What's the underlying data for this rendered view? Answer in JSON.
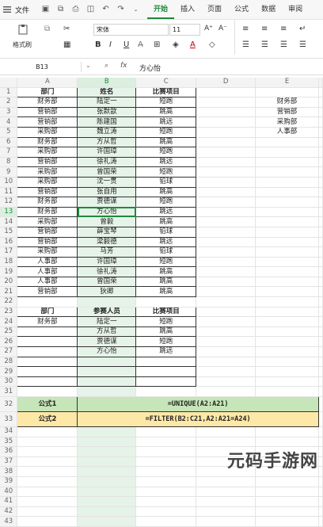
{
  "menubar": {
    "file_label": "文件"
  },
  "tabs": [
    "开始",
    "插入",
    "页面",
    "公式",
    "数据",
    "审阅"
  ],
  "ribbon": {
    "format_brush": "格式刷",
    "font": "宋体",
    "font_size": "11",
    "bold": "B",
    "italic": "I",
    "underline": "U",
    "font_color_label": "A"
  },
  "formula_bar": {
    "cell_ref": "B13",
    "fx": "fx",
    "value": "方心怡"
  },
  "columns": [
    "A",
    "B",
    "C",
    "D",
    "E"
  ],
  "rows": [
    {
      "n": "1",
      "a": "部门",
      "b": "姓名",
      "c": "比赛项目",
      "e": ""
    },
    {
      "n": "2",
      "a": "财务部",
      "b": "陆定一",
      "c": "短跑",
      "e": "财务部"
    },
    {
      "n": "3",
      "a": "营销部",
      "b": "张默歆",
      "c": "跳高",
      "e": "营销部"
    },
    {
      "n": "4",
      "a": "营销部",
      "b": "陈建国",
      "c": "跳远",
      "e": "采购部"
    },
    {
      "n": "5",
      "a": "采购部",
      "b": "魏立涛",
      "c": "短跑",
      "e": "人事部"
    },
    {
      "n": "6",
      "a": "财务部",
      "b": "方从哲",
      "c": "跳高",
      "e": ""
    },
    {
      "n": "7",
      "a": "采购部",
      "b": "许国璋",
      "c": "短跑",
      "e": ""
    },
    {
      "n": "8",
      "a": "营销部",
      "b": "徐礼涛",
      "c": "跳远",
      "e": ""
    },
    {
      "n": "9",
      "a": "采购部",
      "b": "曾国荣",
      "c": "短跑",
      "e": ""
    },
    {
      "n": "10",
      "a": "采购部",
      "b": "沈一贯",
      "c": "铅球",
      "e": ""
    },
    {
      "n": "11",
      "a": "营销部",
      "b": "张自用",
      "c": "跳高",
      "e": ""
    },
    {
      "n": "12",
      "a": "财务部",
      "b": "贾德谋",
      "c": "短跑",
      "e": ""
    },
    {
      "n": "13",
      "a": "财务部",
      "b": "方心怡",
      "c": "跳远",
      "e": ""
    },
    {
      "n": "14",
      "a": "采购部",
      "b": "曾毅",
      "c": "跳高",
      "e": ""
    },
    {
      "n": "15",
      "a": "营销部",
      "b": "薛宝琴",
      "c": "铅球",
      "e": ""
    },
    {
      "n": "16",
      "a": "营销部",
      "b": "梁毅德",
      "c": "跳远",
      "e": ""
    },
    {
      "n": "17",
      "a": "采购部",
      "b": "马芳",
      "c": "铅球",
      "e": ""
    },
    {
      "n": "18",
      "a": "人事部",
      "b": "许国璋",
      "c": "短跑",
      "e": ""
    },
    {
      "n": "19",
      "a": "人事部",
      "b": "徐礼涛",
      "c": "跳高",
      "e": ""
    },
    {
      "n": "20",
      "a": "人事部",
      "b": "曾国荣",
      "c": "跳高",
      "e": ""
    },
    {
      "n": "21",
      "a": "营销部",
      "b": "狄卿",
      "c": "跳高",
      "e": ""
    }
  ],
  "table2": [
    {
      "n": "23",
      "a": "部门",
      "b": "参赛人员",
      "c": "比赛项目"
    },
    {
      "n": "24",
      "a": "财务部",
      "b": "陆定一",
      "c": "短跑"
    },
    {
      "n": "25",
      "a": "",
      "b": "方从哲",
      "c": "跳高"
    },
    {
      "n": "26",
      "a": "",
      "b": "贾德谋",
      "c": "短跑"
    },
    {
      "n": "27",
      "a": "",
      "b": "方心怡",
      "c": "跳远"
    },
    {
      "n": "28",
      "a": "",
      "b": "",
      "c": ""
    },
    {
      "n": "29",
      "a": "",
      "b": "",
      "c": ""
    },
    {
      "n": "30",
      "a": "",
      "b": "",
      "c": ""
    }
  ],
  "formulas": [
    {
      "n": "32",
      "label": "公式1",
      "formula": "=UNIQUE(A2:A21)"
    },
    {
      "n": "33",
      "label": "公式2",
      "formula": "=FILTER(B2:C21,A2:A21=A24)"
    }
  ],
  "empty_rows": [
    "34",
    "35",
    "36",
    "37",
    "38",
    "39",
    "40",
    "41",
    "42",
    "43"
  ],
  "watermark": "元码手游网",
  "colors": {
    "accent": "#1e8a3c",
    "formula1_bg": "#c6e5b8",
    "formula2_bg": "#fde8a8"
  }
}
